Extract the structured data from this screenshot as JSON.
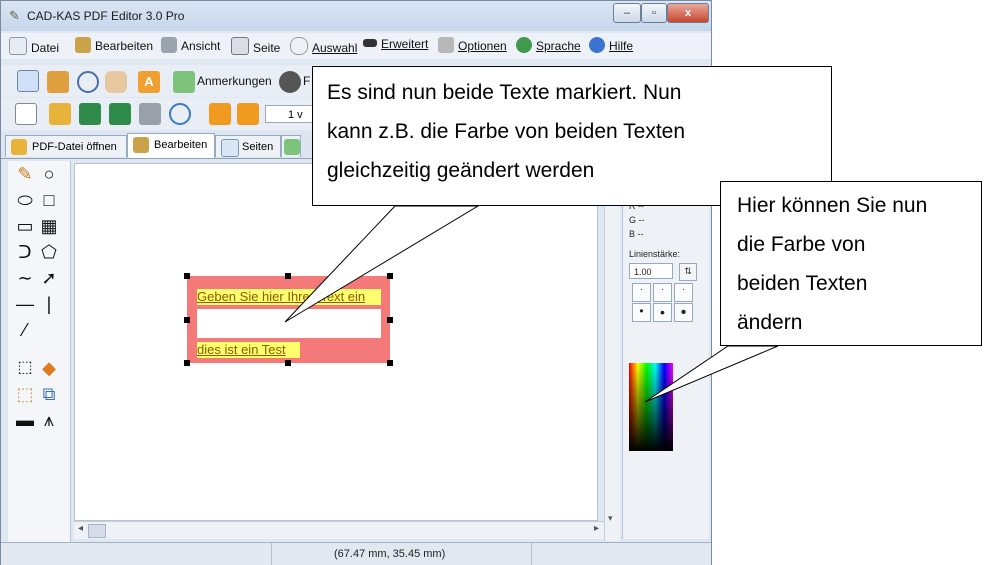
{
  "window": {
    "title": "CAD-KAS PDF Editor 3.0 Pro",
    "min_label": "–",
    "max_label": "▫",
    "close_label": "x"
  },
  "menu": {
    "items": [
      "Datei",
      "Bearbeiten",
      "Ansicht",
      "Seite",
      "Auswahl",
      "Erweitert",
      "Optionen",
      "Sprache",
      "Hilfe"
    ]
  },
  "toolbar": {
    "anmerkungen_label": "Anmerkungen",
    "r_label": "F",
    "page_input": "1 v"
  },
  "tabs": [
    "PDF-Datei öffnen",
    "Bearbeiten",
    "Seiten"
  ],
  "canvas": {
    "textbox1": "Geben Sie hier Ihren Text ein",
    "textbox2": "dies ist ein Test"
  },
  "rightpanel": {
    "r_label": "R --",
    "g_label": "G --",
    "b_label": "B --",
    "linienstaerke_label": "Linienstärke:",
    "linienstaerke_value": "1.00"
  },
  "status": {
    "coords": "(67.47 mm, 35.45 mm)"
  },
  "callouts": {
    "main": [
      "Es sind nun beide Texte markiert. Nun",
      "kann z.B. die Farbe von beiden Texten",
      "gleichzeitig geändert werden"
    ],
    "right": [
      "Hier können Sie nun",
      "die Farbe von",
      "beiden Texten",
      "ändern"
    ]
  },
  "colors": {
    "selection": "#f47a7a",
    "textbg": "#ffff6e",
    "callout_border": "#000000"
  }
}
